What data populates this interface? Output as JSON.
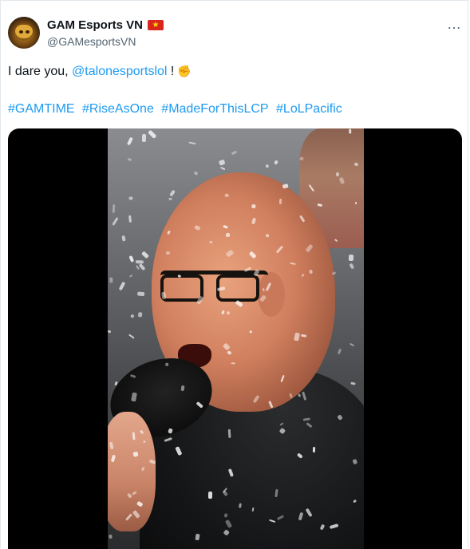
{
  "tweet": {
    "author": {
      "display_name": "GAM Esports VN",
      "handle": "@GAMesportsVN",
      "flag_icon": "vietnam-flag-icon",
      "flag_glyph": "★"
    },
    "more_icon": "…",
    "text": {
      "prefix": "I dare you, ",
      "mention": "@talonesportslol",
      "suffix": " !",
      "emoji": "✊"
    },
    "hashtags": [
      "#GAMTIME",
      "#RiseAsOne",
      "#MadeForThisLCP",
      "#LoLPacific"
    ],
    "colors": {
      "accent": "#1d9bf0",
      "text": "#0f1419",
      "secondary": "#536471",
      "flag_red": "#da251d",
      "flag_star": "#ffdd00"
    }
  }
}
